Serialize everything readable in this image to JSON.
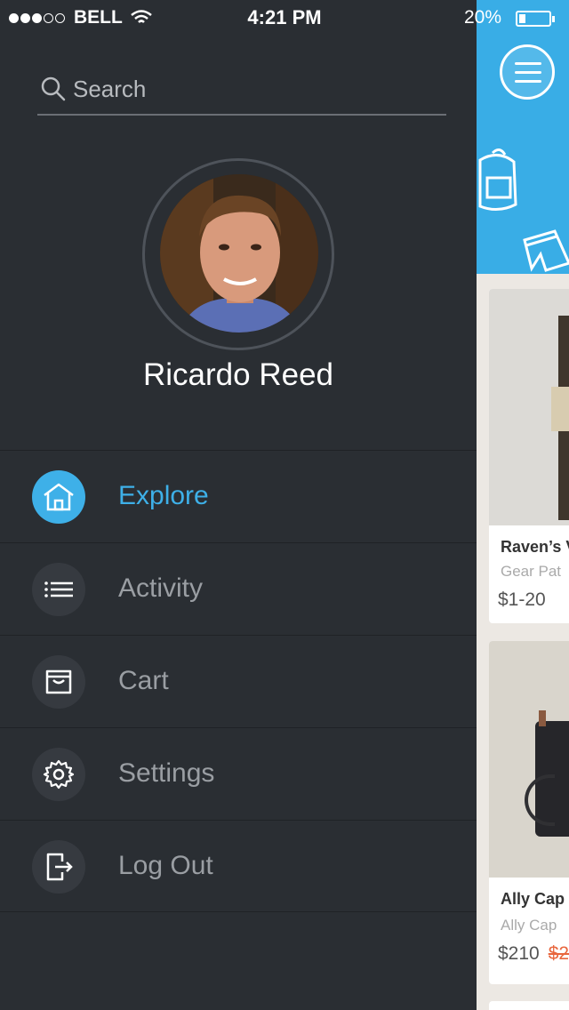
{
  "status_bar": {
    "carrier": "BELL",
    "time": "4:21 PM",
    "battery": "20%"
  },
  "sidebar": {
    "search_placeholder": "Search",
    "user_name": "Ricardo Reed",
    "menu": [
      {
        "label": "Explore",
        "icon": "home-icon",
        "active": true
      },
      {
        "label": "Activity",
        "icon": "list-icon",
        "active": false
      },
      {
        "label": "Cart",
        "icon": "bag-icon",
        "active": false
      },
      {
        "label": "Settings",
        "icon": "gear-icon",
        "active": false
      },
      {
        "label": "Log Out",
        "icon": "logout-icon",
        "active": false
      }
    ]
  },
  "content": {
    "products": [
      {
        "title": "Raven’s V",
        "subtitle": "Gear Pat",
        "price": "$1-20",
        "old_price": ""
      },
      {
        "title": "Ally Cap",
        "subtitle": "Ally Cap",
        "price": "$210",
        "old_price": "$2"
      }
    ]
  },
  "colors": {
    "accent": "#3eb0e8",
    "sidebar_bg": "#2a2e33",
    "sale": "#e8663d"
  }
}
